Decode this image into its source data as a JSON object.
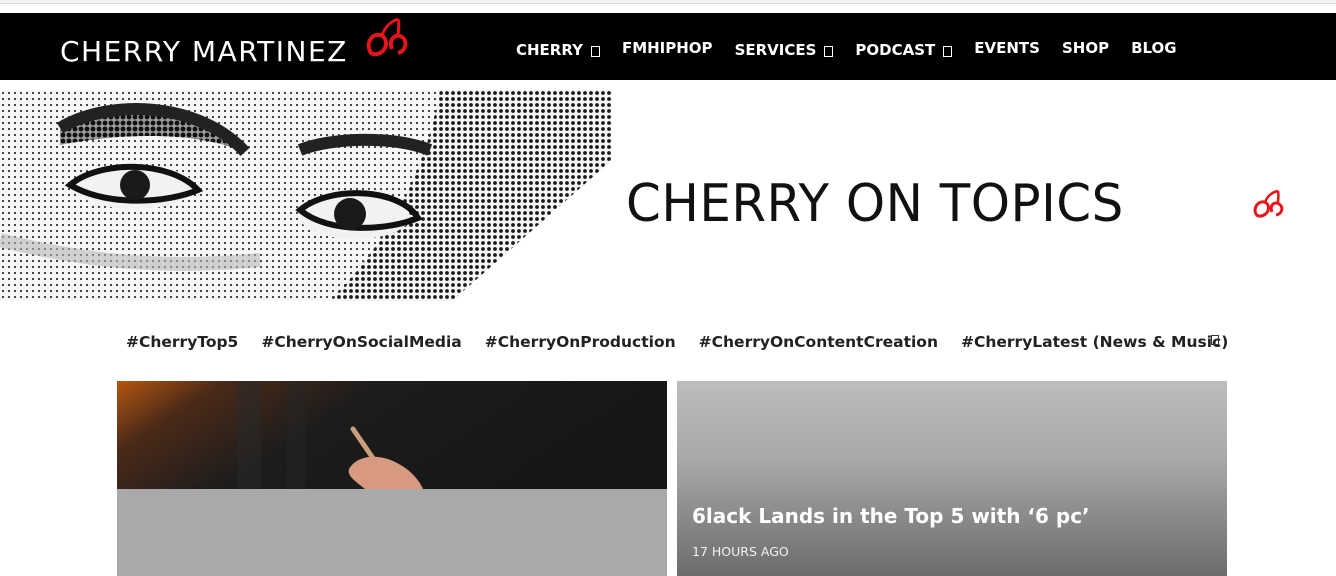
{
  "header": {
    "logo_text": "CHERRY MARTINEZ",
    "nav": [
      {
        "label": "CHERRY",
        "has_dropdown": true
      },
      {
        "label": "FMHIPHOP",
        "has_dropdown": false
      },
      {
        "label": "SERVICES",
        "has_dropdown": true
      },
      {
        "label": "PODCAST",
        "has_dropdown": true
      },
      {
        "label": "EVENTS",
        "has_dropdown": false
      },
      {
        "label": "SHOP",
        "has_dropdown": false
      },
      {
        "label": "BLOG",
        "has_dropdown": false
      }
    ]
  },
  "banner": {
    "title": "CHERRY ON TOPICS",
    "accent_color": "#e8141c"
  },
  "tags": [
    "#CherryTop5",
    "#CherryOnSocialMedia",
    "#CherryOnProduction",
    "#CherryOnContentCreation",
    "#CherryLatest (News & Music)"
  ],
  "posts": [
    {
      "title": "6lack Lands in the Top 5 with ‘6 pc’",
      "time": "17 HOURS AGO"
    }
  ],
  "icons": {
    "logo_mark": "cherry-icon",
    "dropdown": "chevron-down-icon",
    "tag_toggle": "menu-toggle-icon"
  }
}
